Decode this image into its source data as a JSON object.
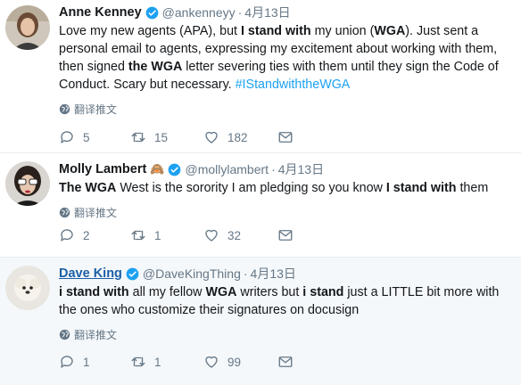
{
  "tweets": [
    {
      "name": "Anne Kenney",
      "handle": "@ankenneyy",
      "dot": "·",
      "date": "4月13日",
      "translate": "翻译推文",
      "text": {
        "p1": "Love my new agents (APA), but ",
        "b1": "I stand with",
        "p2": " my union (",
        "b2": "WGA",
        "p3": "). Just sent a personal email to agents, expressing my excitement about working with them, then signed ",
        "b3": "the WGA",
        "p4": " letter severing ties with them until they sign the Code of Conduct. Scary but necessary. ",
        "hashtag": "#IStandwiththeWGA"
      },
      "replies": "5",
      "retweets": "15",
      "likes": "182"
    },
    {
      "name": "Molly Lambert",
      "emoji": "🙈",
      "handle": "@mollylambert",
      "dot": "·",
      "date": "4月13日",
      "translate": "翻译推文",
      "text": {
        "b1": "The WGA",
        "p1": " West is the sorority I am pledging so you know ",
        "b2": "I stand with",
        "p2": " them"
      },
      "replies": "2",
      "retweets": "1",
      "likes": "32"
    },
    {
      "name": "Dave King",
      "handle": "@DaveKingThing",
      "dot": "·",
      "date": "4月13日",
      "translate": "翻译推文",
      "text": {
        "b1": "i stand with",
        "p1": " all my fellow ",
        "b2": "WGA",
        "p2": " writers but ",
        "b3": "i stand",
        "p3": " just a LITTLE bit more with the ones who customize their signatures on docusign"
      },
      "replies": "1",
      "retweets": "1",
      "likes": "99"
    }
  ],
  "colors": {
    "verified": "#1da1f2",
    "hashtag": "#1da1f2",
    "muted": "#657786",
    "highlight_bg": "#f5f8fa"
  },
  "icons": [
    "verified-badge-icon",
    "globe-icon",
    "reply-icon",
    "retweet-icon",
    "like-icon",
    "message-icon"
  ]
}
